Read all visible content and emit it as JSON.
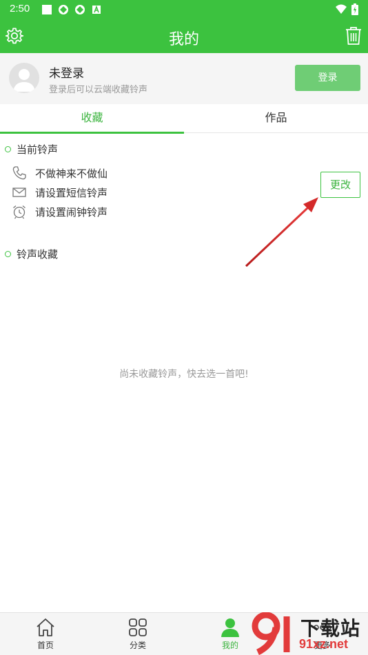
{
  "status_bar": {
    "time": "2:50"
  },
  "header": {
    "title": "我的"
  },
  "profile": {
    "name": "未登录",
    "hint": "登录后可以云端收藏铃声",
    "login_label": "登录"
  },
  "tabs": [
    {
      "label": "收藏"
    },
    {
      "label": "作品"
    }
  ],
  "current": {
    "title": "当前铃声",
    "items": [
      {
        "icon": "phone-icon",
        "text": "不做神来不做仙"
      },
      {
        "icon": "message-icon",
        "text": "请设置短信铃声"
      },
      {
        "icon": "alarm-icon",
        "text": "请设置闹钟铃声"
      }
    ],
    "change_label": "更改"
  },
  "favorites": {
    "title": "铃声收藏",
    "empty_text": "尚未收藏铃声，快去选一首吧!"
  },
  "bottom_nav": [
    {
      "label": "首页",
      "icon": "home-icon"
    },
    {
      "label": "分类",
      "icon": "grid-icon"
    },
    {
      "label": "我的",
      "icon": "person-icon",
      "active": true
    },
    {
      "label": "更多",
      "icon": "more-icon"
    }
  ],
  "watermark": {
    "text": "下载站",
    "url": "91xz.net"
  },
  "colors": {
    "accent": "#3cc23f",
    "button_light": "#6fcd75",
    "annotation_arrow": "#d42a2a"
  }
}
